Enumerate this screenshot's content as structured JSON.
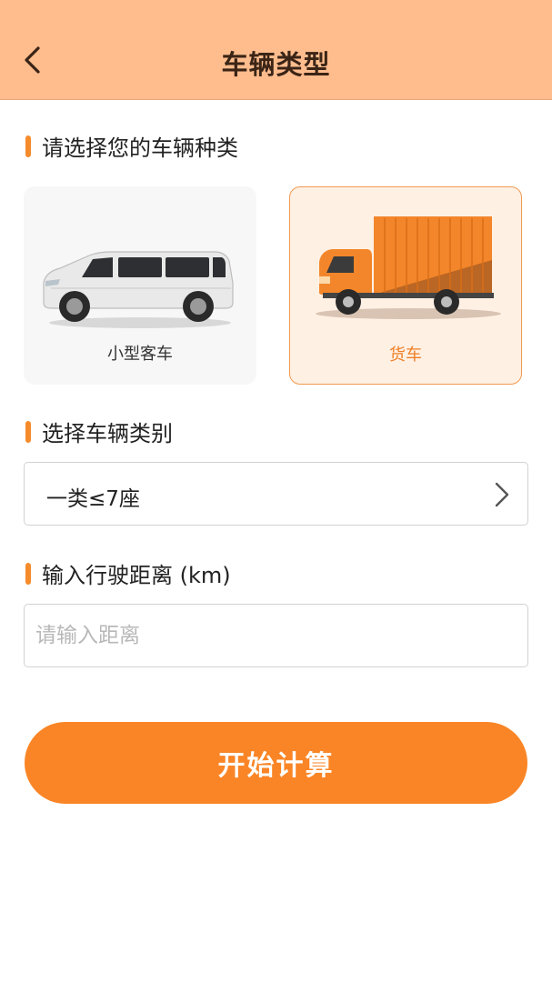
{
  "header": {
    "title": "车辆类型",
    "back_icon": "chevron-left-icon"
  },
  "vehicle_section": {
    "title": "请选择您的车辆种类",
    "options": [
      {
        "label": "小型客车",
        "icon": "minivan-image",
        "selected": false
      },
      {
        "label": "货车",
        "icon": "truck-image",
        "selected": true
      }
    ]
  },
  "category_section": {
    "title": "选择车辆类别",
    "selected_value": "一类≤7座",
    "chevron_icon": "chevron-right-icon"
  },
  "distance_section": {
    "title": "输入行驶距离 (km)",
    "placeholder": "请输入距离",
    "value": ""
  },
  "action": {
    "start_label": "开始计算"
  },
  "colors": {
    "header_bg": "#ffbd8e",
    "accent": "#fa8526",
    "selected_card_bg": "#fff0e4",
    "selected_card_border": "#f19a50"
  }
}
